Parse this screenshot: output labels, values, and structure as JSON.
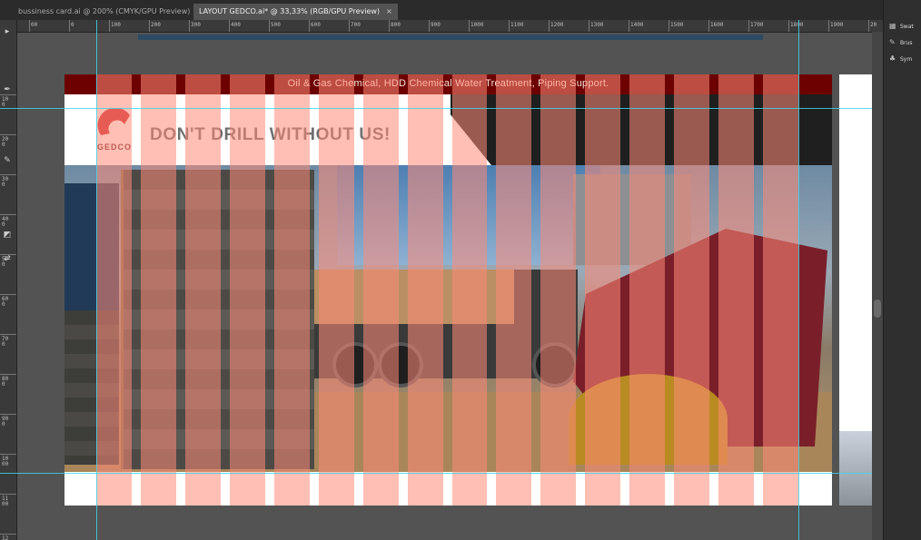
{
  "tabs": [
    {
      "label": "bussiness card.ai @ 200% (CMYK/GPU Preview)",
      "active": false
    },
    {
      "label": "LAYOUT GEDCO.ai* @ 33,33% (RGB/GPU Preview)",
      "active": true
    }
  ],
  "tab_close_glyph": "×",
  "ruler": {
    "top_labels": [
      "00",
      "0",
      "100",
      "200",
      "300",
      "400",
      "500",
      "600",
      "700",
      "800",
      "900",
      "1000",
      "1100",
      "1200",
      "1300",
      "1400",
      "1500",
      "1600",
      "1700",
      "1800",
      "1900",
      "20"
    ],
    "left_labels": [
      "100",
      "200",
      "300",
      "400",
      "500",
      "600",
      "700",
      "800",
      "900",
      "1000",
      "1100",
      "12"
    ]
  },
  "panel": {
    "items": [
      {
        "icon": "swatches-icon",
        "glyph": "▦",
        "label": "Swat"
      },
      {
        "icon": "brushes-icon",
        "glyph": "✎",
        "label": "Brus"
      },
      {
        "icon": "symbols-icon",
        "glyph": "♣",
        "label": "Sym"
      }
    ]
  },
  "artboard": {
    "top_bar_text": "Oil & Gas Chemical, HDD Chemical Water Treatment, Piping Support.",
    "logo_text": "GEDCO",
    "slogan": "DON'T DRILL WITHOUT US!"
  },
  "colors": {
    "top_bar": "#6d0000",
    "logo_red": "#c8242b",
    "overlay_column": "#ff8a78",
    "guide": "#41d4e8"
  },
  "overlay": {
    "column_count": 16
  }
}
